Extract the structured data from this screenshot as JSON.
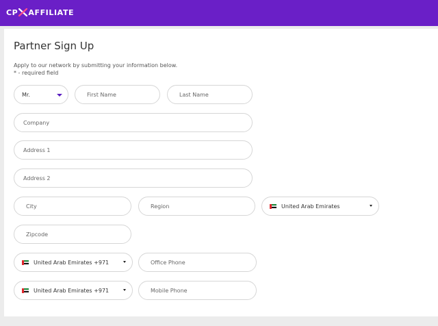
{
  "brand": {
    "name_left": "CP",
    "name_right": "AFFILIATE",
    "logo_icon": "x-mark-logo"
  },
  "form": {
    "title": "Partner Sign Up",
    "intro_line1": "Apply to our network by submitting your information below.",
    "intro_line2": "* - required field",
    "salutation": "Mr.",
    "first_name_placeholder": "First Name",
    "last_name_placeholder": "Last Name",
    "company_placeholder": "Company",
    "address1_placeholder": "Address 1",
    "address2_placeholder": "Address 2",
    "city_placeholder": "City",
    "region_placeholder": "Region",
    "country": "United Arab Emirates",
    "zipcode_placeholder": "Zipcode",
    "office_phone_country": "United Arab Emirates +971",
    "office_phone_placeholder": "Office Phone",
    "mobile_phone_country": "United Arab Emirates +971",
    "mobile_phone_placeholder": "Mobile Phone"
  },
  "colors": {
    "header": "#6a1fc7",
    "accent_caret": "#5a1cc0",
    "field_border": "#d6d6d6",
    "page_bg": "#ececec"
  },
  "icons": {
    "flag": "uae-flag-icon",
    "dropdown": "caret-down-icon"
  }
}
